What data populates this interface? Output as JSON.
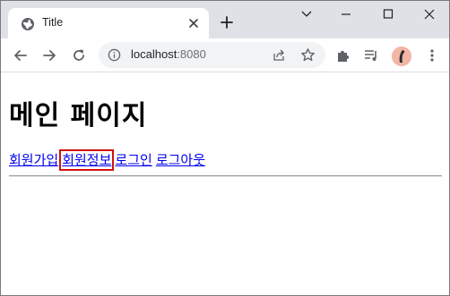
{
  "browser": {
    "tab_title": "Title",
    "url_host": "localhost",
    "url_port": ":8080",
    "icons": {
      "favicon": "globe-icon",
      "close": "close-icon",
      "new_tab": "plus-icon",
      "back": "back-arrow-icon",
      "forward": "forward-arrow-icon",
      "reload": "reload-icon",
      "info": "info-icon",
      "share": "share-icon",
      "bookmark": "star-icon",
      "extensions": "puzzle-icon",
      "media": "media-queue-icon",
      "menu": "kebab-menu-icon"
    }
  },
  "page": {
    "title": "메인 페이지",
    "nav": [
      {
        "label": "회원가입"
      },
      {
        "label": "회원정보"
      },
      {
        "label": "로그인"
      },
      {
        "label": "로그아웃"
      }
    ]
  },
  "colors": {
    "link": "#0000ee",
    "highlight": "#d01010",
    "tabstrip": "#dee1e6"
  }
}
